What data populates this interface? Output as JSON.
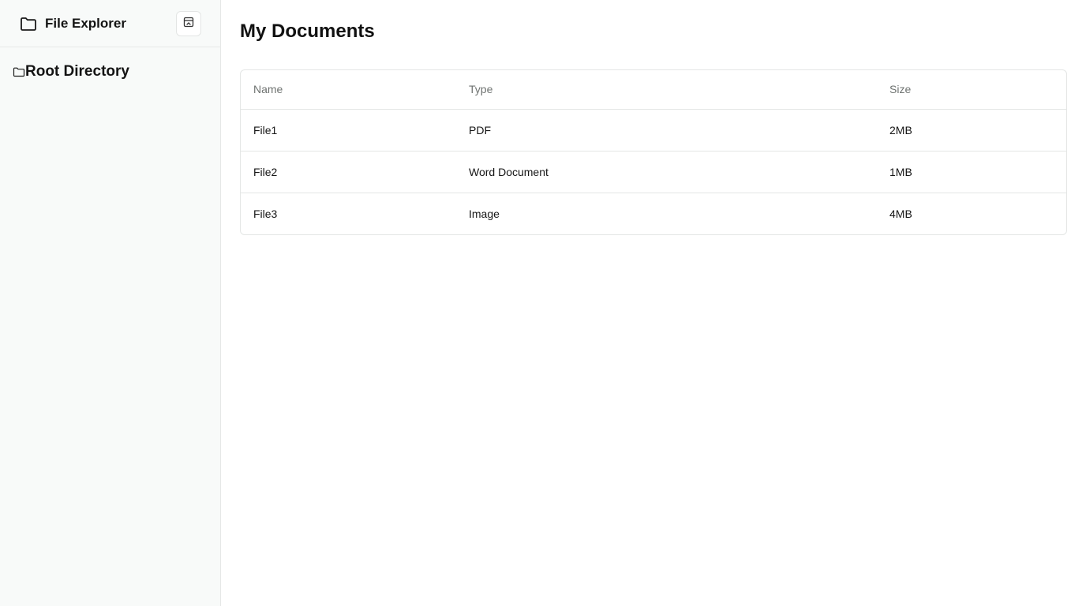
{
  "sidebar": {
    "title": "File Explorer",
    "title_icon": "folder-icon",
    "collapse_icon": "panel-collapse-icon",
    "tree": [
      {
        "label": "Root Directory",
        "icon": "folder-icon"
      }
    ]
  },
  "main": {
    "title": "My Documents",
    "table": {
      "columns": [
        "Name",
        "Type",
        "Size"
      ],
      "rows": [
        {
          "name": "File1",
          "type": "PDF",
          "size": "2MB"
        },
        {
          "name": "File2",
          "type": "Word Document",
          "size": "1MB"
        },
        {
          "name": "File3",
          "type": "Image",
          "size": "4MB"
        }
      ]
    }
  },
  "colors": {
    "sidebar_bg": "#f8faf9",
    "border": "#e4e6e5",
    "header_text": "#6f7371",
    "text": "#111111"
  }
}
